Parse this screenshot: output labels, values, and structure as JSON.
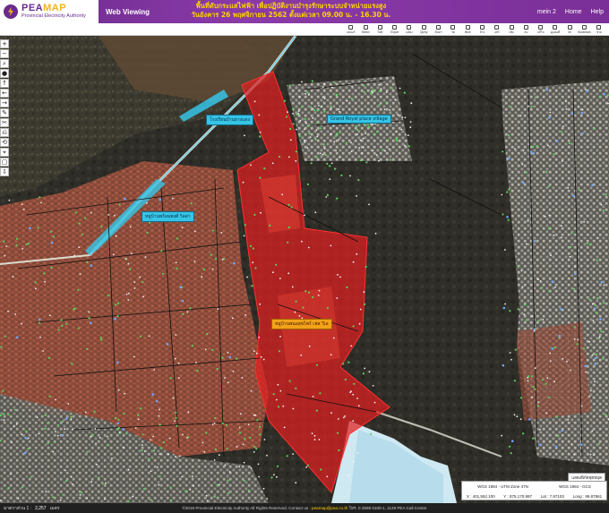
{
  "header": {
    "logo_title_a": "PEA",
    "logo_title_b": "MAP",
    "logo_subtitle": "Provincial Electricity Authority",
    "app_name": "Web Viewing",
    "announce_line1": "พื้นที่ดับกระแสไฟฟ้า เพื่อปฏิบัติงานบำรุงรักษาระบบจำหน่ายแรงสูง",
    "announce_line2": "วันอังคาร 26 พฤศจิกายน 2562 ตั้งแต่เวลา 09.00 น. - 16.30 น.",
    "nav": [
      "mein 2",
      "Home",
      "Help"
    ]
  },
  "toolbar": {
    "tools": [
      "เลเยอร์",
      "Select",
      "ไฟล์",
      "Export",
      "แสดง",
      "Query",
      "ค้นหา",
      "วัด",
      "พิมพ์",
      "ล้าง",
      "แชร์",
      "เพิ่ม",
      "ลบ",
      "แก้ไข",
      "ดูแผนที่",
      "ปัก",
      "Bookmark",
      "ช่วย"
    ]
  },
  "map": {
    "road_labels": [
      "โรงเรียนบ้านยางแดง",
      "Grand Royal place village",
      "หมู่บ้านพร้อมพงศ์ วิลล่า"
    ],
    "zone_label": "หมู่บ้านพนอสุขไพร์ เฟส วีเอ",
    "controls": [
      "+",
      "−",
      "⌕",
      "●",
      "↑",
      "←",
      "→",
      "✎",
      "✂",
      "⎌",
      "⟲",
      "⌖",
      "▢",
      "⇩"
    ]
  },
  "coords": {
    "button": "แสดงพิกัดจุดหมุด",
    "row1": [
      "WGS 1984 - UTM Zone 47N",
      "WGS 1984 - GCS"
    ],
    "row2": [
      "X : 401,552.100",
      "Y : 875,170.997",
      "Lat : 7.97103",
      "Long : 99.87861"
    ]
  },
  "footer": {
    "scale_label": "มาตราส่วน 1 :",
    "scale_value": "2,257",
    "unit": "เมตร",
    "copyright": "©2019 Provincial Electricity Authority All Rights Reserved. Contact us :",
    "email": "peamap@pea.co.th",
    "copyright_tail": "โทร. 0 2589 0100-1, 1129 PEA Call Center"
  },
  "colors": {
    "header_purple": "#7a2f98",
    "outage_zone": "#e02020",
    "label_cyan": "#36c4e6",
    "label_orange": "#f3a21a",
    "announce_yellow": "#ffd400"
  }
}
